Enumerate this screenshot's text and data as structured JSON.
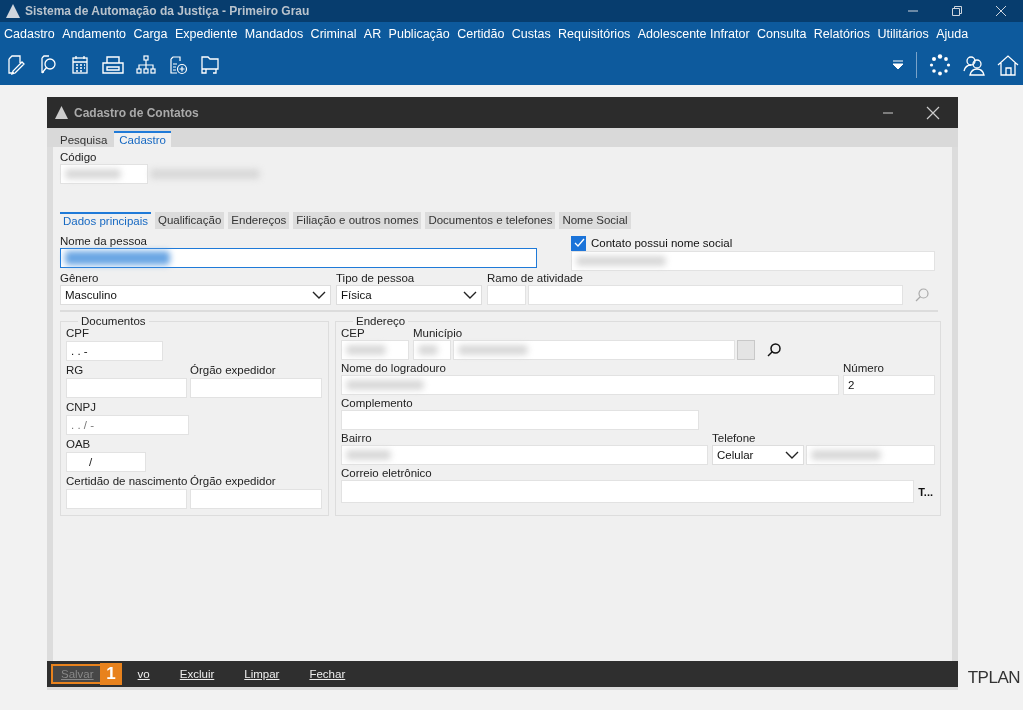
{
  "app": {
    "title": "Sistema de Automação da Justiça - Primeiro Grau"
  },
  "menu": [
    "Cadastro",
    "Andamento",
    "Carga",
    "Expediente",
    "Mandados",
    "Criminal",
    "AR",
    "Publicação",
    "Certidão",
    "Custas",
    "Requisitórios",
    "Adolescente Infrator",
    "Consulta",
    "Relatórios",
    "Utilitários",
    "Ajuda"
  ],
  "background_logo": "TPLAN",
  "dialog": {
    "title": "Cadastro de Contatos",
    "tabs": [
      {
        "label": "Pesquisa",
        "selected": false
      },
      {
        "label": "Cadastro",
        "selected": true
      }
    ],
    "code": {
      "label": "Código",
      "redacted": true,
      "description_redacted": true
    },
    "subtabs": [
      {
        "label": "Dados principais",
        "selected": true
      },
      {
        "label": "Qualificação",
        "selected": false
      },
      {
        "label": "Endereços",
        "selected": false
      },
      {
        "label": "Filiação e outros nomes",
        "selected": false
      },
      {
        "label": "Documentos e telefones",
        "selected": false
      },
      {
        "label": "Nome Social",
        "selected": false
      }
    ],
    "person_name": {
      "label": "Nome da pessoa",
      "redacted": true,
      "focused": true
    },
    "social_name": {
      "label": "Contato possui nome social",
      "checked": true,
      "redacted": true
    },
    "gender": {
      "label": "Gênero",
      "value": "Masculino"
    },
    "person_type": {
      "label": "Tipo de pessoa",
      "value": "Física"
    },
    "activity": {
      "label": "Ramo de atividade"
    },
    "documents": {
      "title": "Documentos",
      "cpf": {
        "label": "CPF",
        "value": ". . -"
      },
      "rg": {
        "label": "RG"
      },
      "rg_issuer": {
        "label": "Órgão expedidor"
      },
      "cnpj": {
        "label": "CNPJ",
        "placeholder": ". . / -"
      },
      "oab": {
        "label": "OAB",
        "value": "/"
      },
      "birth_cert": {
        "label": "Certidão de nascimento"
      },
      "birth_issuer": {
        "label": "Órgão expedidor"
      }
    },
    "address": {
      "title": "Endereço",
      "cep": {
        "label": "CEP",
        "redacted": true
      },
      "city": {
        "label": "Município",
        "redacted": true
      },
      "street": {
        "label": "Nome do logradouro",
        "redacted": true
      },
      "number": {
        "label": "Número",
        "value": "2"
      },
      "complement": {
        "label": "Complemento"
      },
      "district": {
        "label": "Bairro",
        "redacted": true
      },
      "phone": {
        "label": "Telefone",
        "type": "Celular",
        "redacted": true
      },
      "email": {
        "label": "Correio eletrônico",
        "button": "T..."
      }
    },
    "buttons": [
      {
        "label": "Salvar",
        "disabled": true,
        "highlighted": true
      },
      {
        "label": "vo",
        "disabled": false,
        "highlighted": false
      },
      {
        "label": "Excluir",
        "disabled": false,
        "highlighted": false
      },
      {
        "label": "Limpar",
        "disabled": false,
        "highlighted": false
      },
      {
        "label": "Fechar",
        "disabled": false,
        "highlighted": false
      }
    ],
    "callout": {
      "label": "1"
    }
  }
}
